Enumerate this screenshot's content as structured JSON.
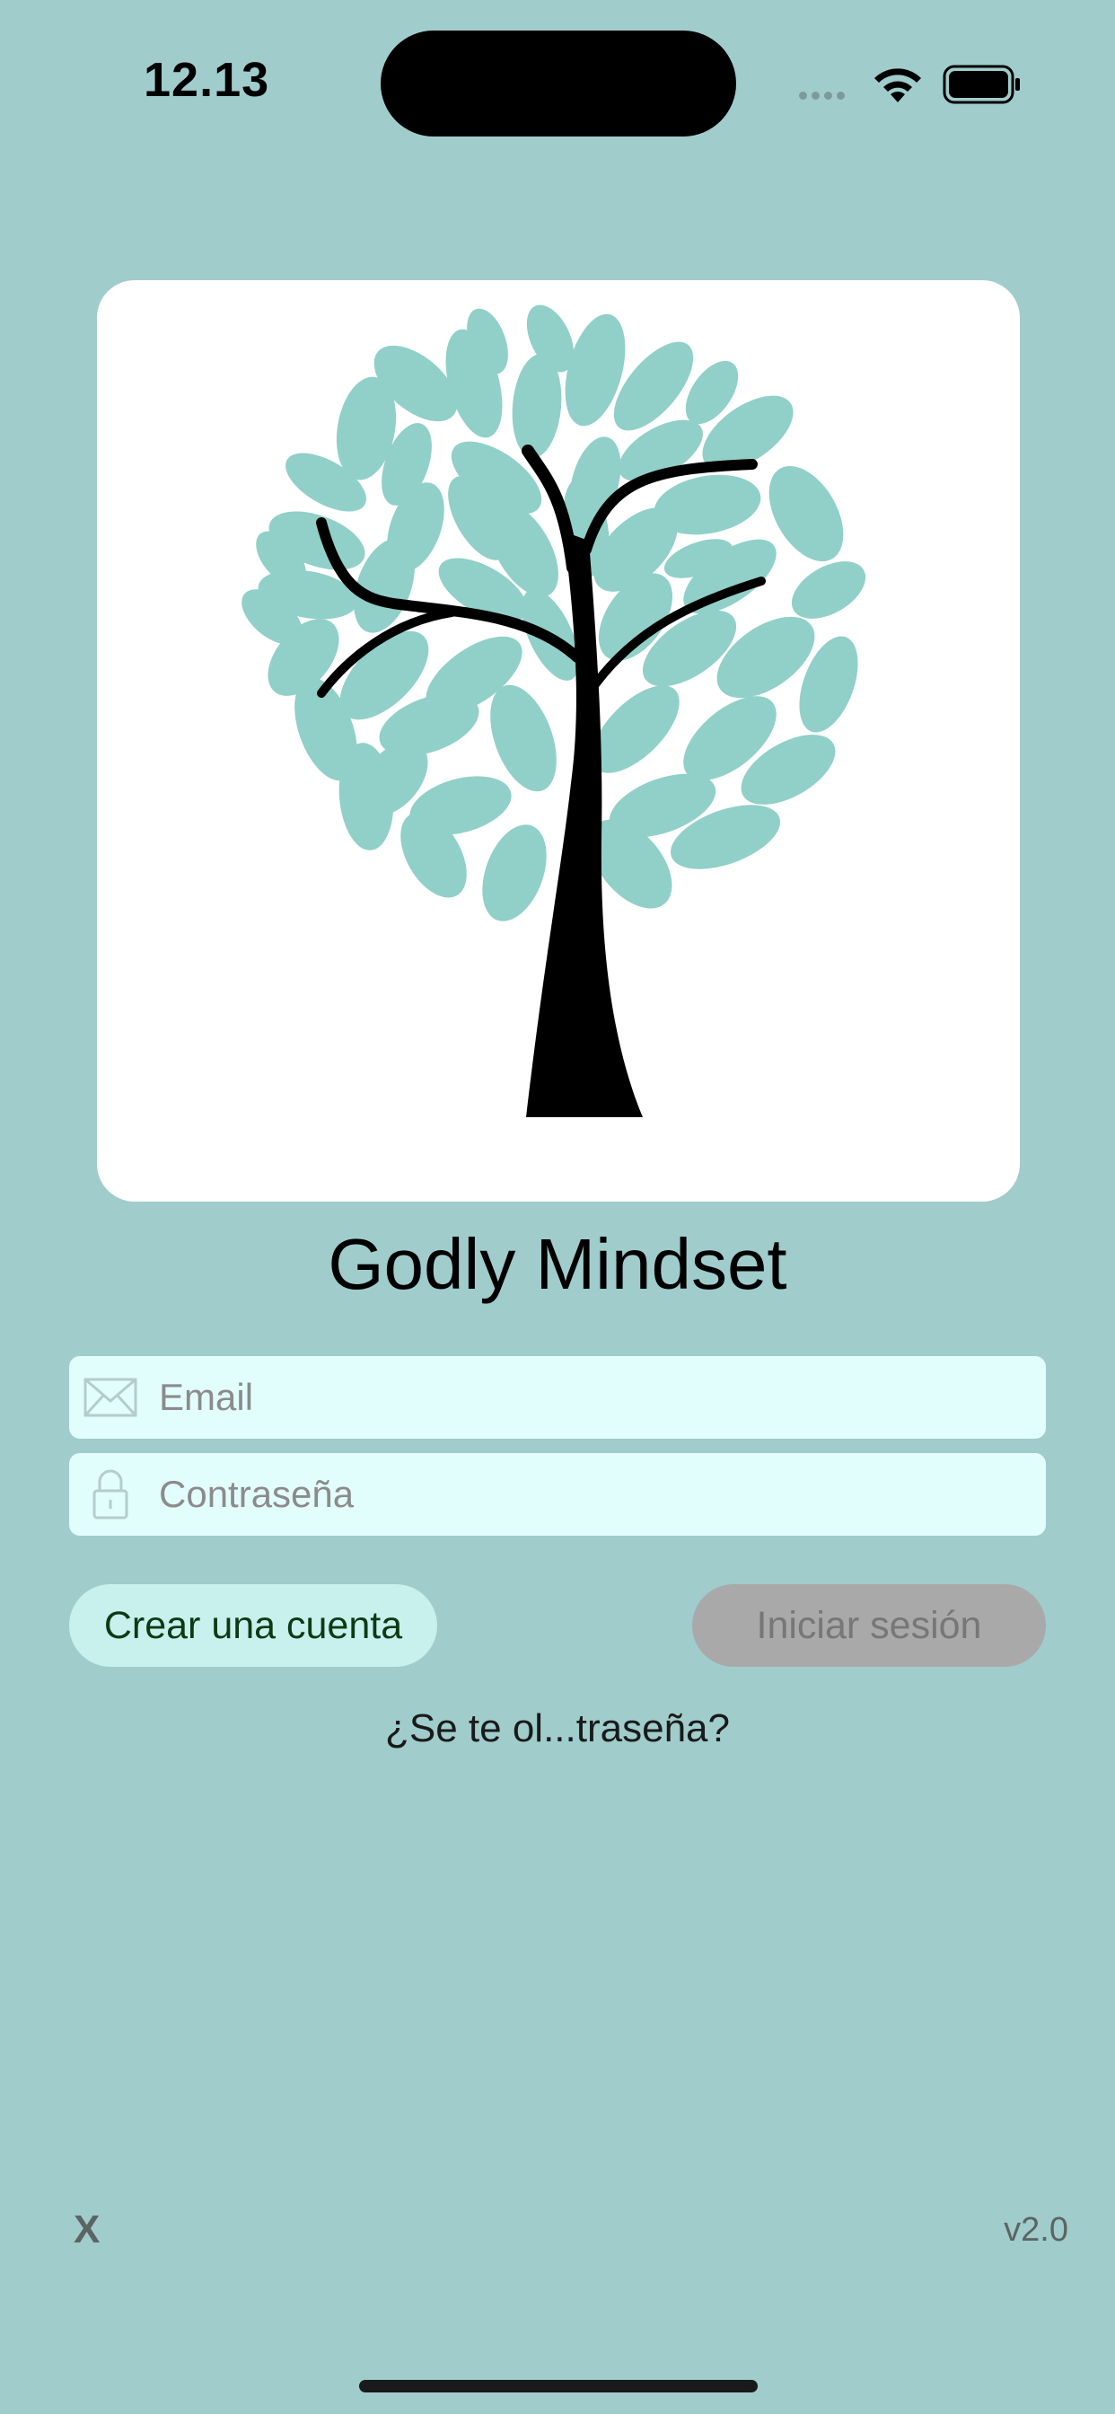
{
  "status_bar": {
    "time": "12.13"
  },
  "app": {
    "title": "Godly Mindset",
    "version": "v2.0",
    "close_label": "X"
  },
  "login_form": {
    "email_placeholder": "Email",
    "password_placeholder": "Contraseña",
    "create_account_label": "Crear una cuenta",
    "login_label": "Iniciar sesión",
    "forgot_password_label": "¿Se te ol...traseña?"
  },
  "icons": {
    "email_field": "envelope-icon",
    "password_field": "lock-icon",
    "logo": "tree-logo"
  },
  "colors": {
    "background": "#a0cccc",
    "field_background": "#e2fefc",
    "create_button": "#c8f0ec",
    "login_button_disabled": "#a9a9a9",
    "leaf": "#90d0c8"
  }
}
